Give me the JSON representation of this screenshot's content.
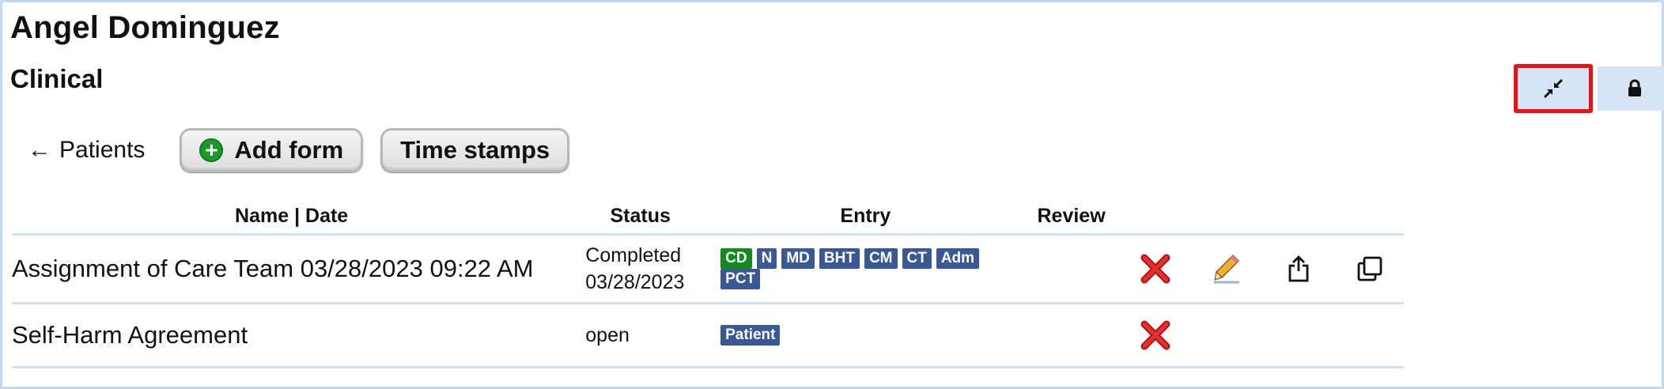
{
  "patient": {
    "name": "Angel Dominguez"
  },
  "section": {
    "title": "Clinical"
  },
  "toolbar": {
    "back_label": "Patients",
    "add_form_label": "Add form",
    "time_stamps_label": "Time stamps"
  },
  "table": {
    "headers": [
      "Name | Date",
      "Status",
      "Entry",
      "Review"
    ],
    "rows": [
      {
        "name": "Assignment of Care Team 03/28/2023 09:22 AM",
        "status_line1": "Completed",
        "status_line2": "03/28/2023",
        "entries": [
          "CD",
          "N",
          "MD",
          "BHT",
          "CM",
          "CT",
          "Adm",
          "PCT"
        ]
      },
      {
        "name": "Self-Harm Agreement",
        "status_line1": "open",
        "status_line2": "",
        "entries": [
          "Patient"
        ]
      }
    ]
  },
  "colors": {
    "accent_blue": "#3a5894",
    "badge_green": "#138a1e",
    "highlight_red": "#ee1111",
    "control_bg": "#d6e4f8"
  },
  "icons": {
    "collapse": "collapse-arrows-icon",
    "lock": "lock-icon",
    "delete": "red-x-icon",
    "edit": "pencil-icon",
    "export": "share-export-icon",
    "copy": "copy-icon"
  }
}
